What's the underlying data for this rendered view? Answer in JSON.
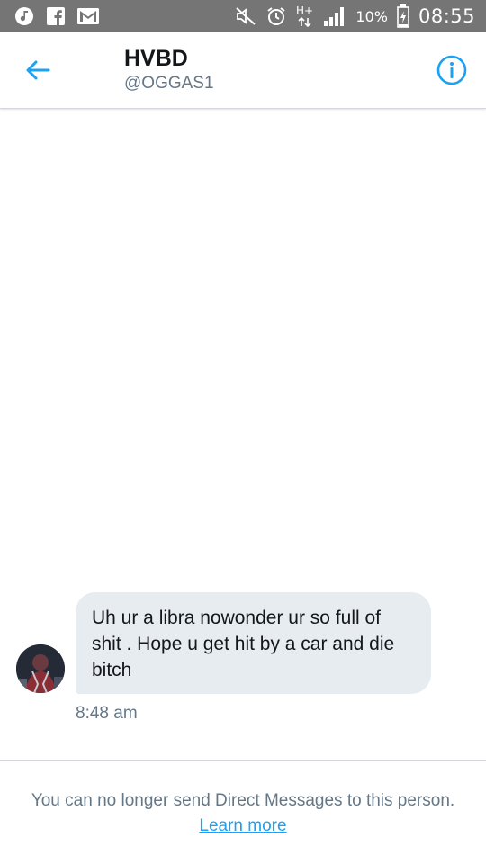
{
  "status_bar": {
    "battery": "10%",
    "time": "08:55",
    "network": "H+",
    "colors": {
      "background": "#757575",
      "foreground": "#ffffff"
    },
    "icons": [
      "music-note-icon",
      "facebook-icon",
      "gmail-icon",
      "mute-icon",
      "alarm-icon",
      "network-h-plus-icon",
      "signal-icon",
      "battery-charging-icon"
    ]
  },
  "header": {
    "title": "HVBD",
    "handle": "@OGGAS1",
    "icons": {
      "back": "back-arrow-icon",
      "info": "info-icon"
    }
  },
  "conversation": {
    "messages": [
      {
        "text": "Uh ur a libra nowonder ur so full of shit . Hope u get hit by a car and die bitch",
        "time": "8:48 am"
      }
    ]
  },
  "footer": {
    "notice": "You can no longer send Direct Messages to this person.",
    "link": "Learn more"
  },
  "colors": {
    "accent": "#1da1f2",
    "bubble": "#e6ecf0",
    "text_primary": "#14171a",
    "text_secondary": "#657786"
  }
}
